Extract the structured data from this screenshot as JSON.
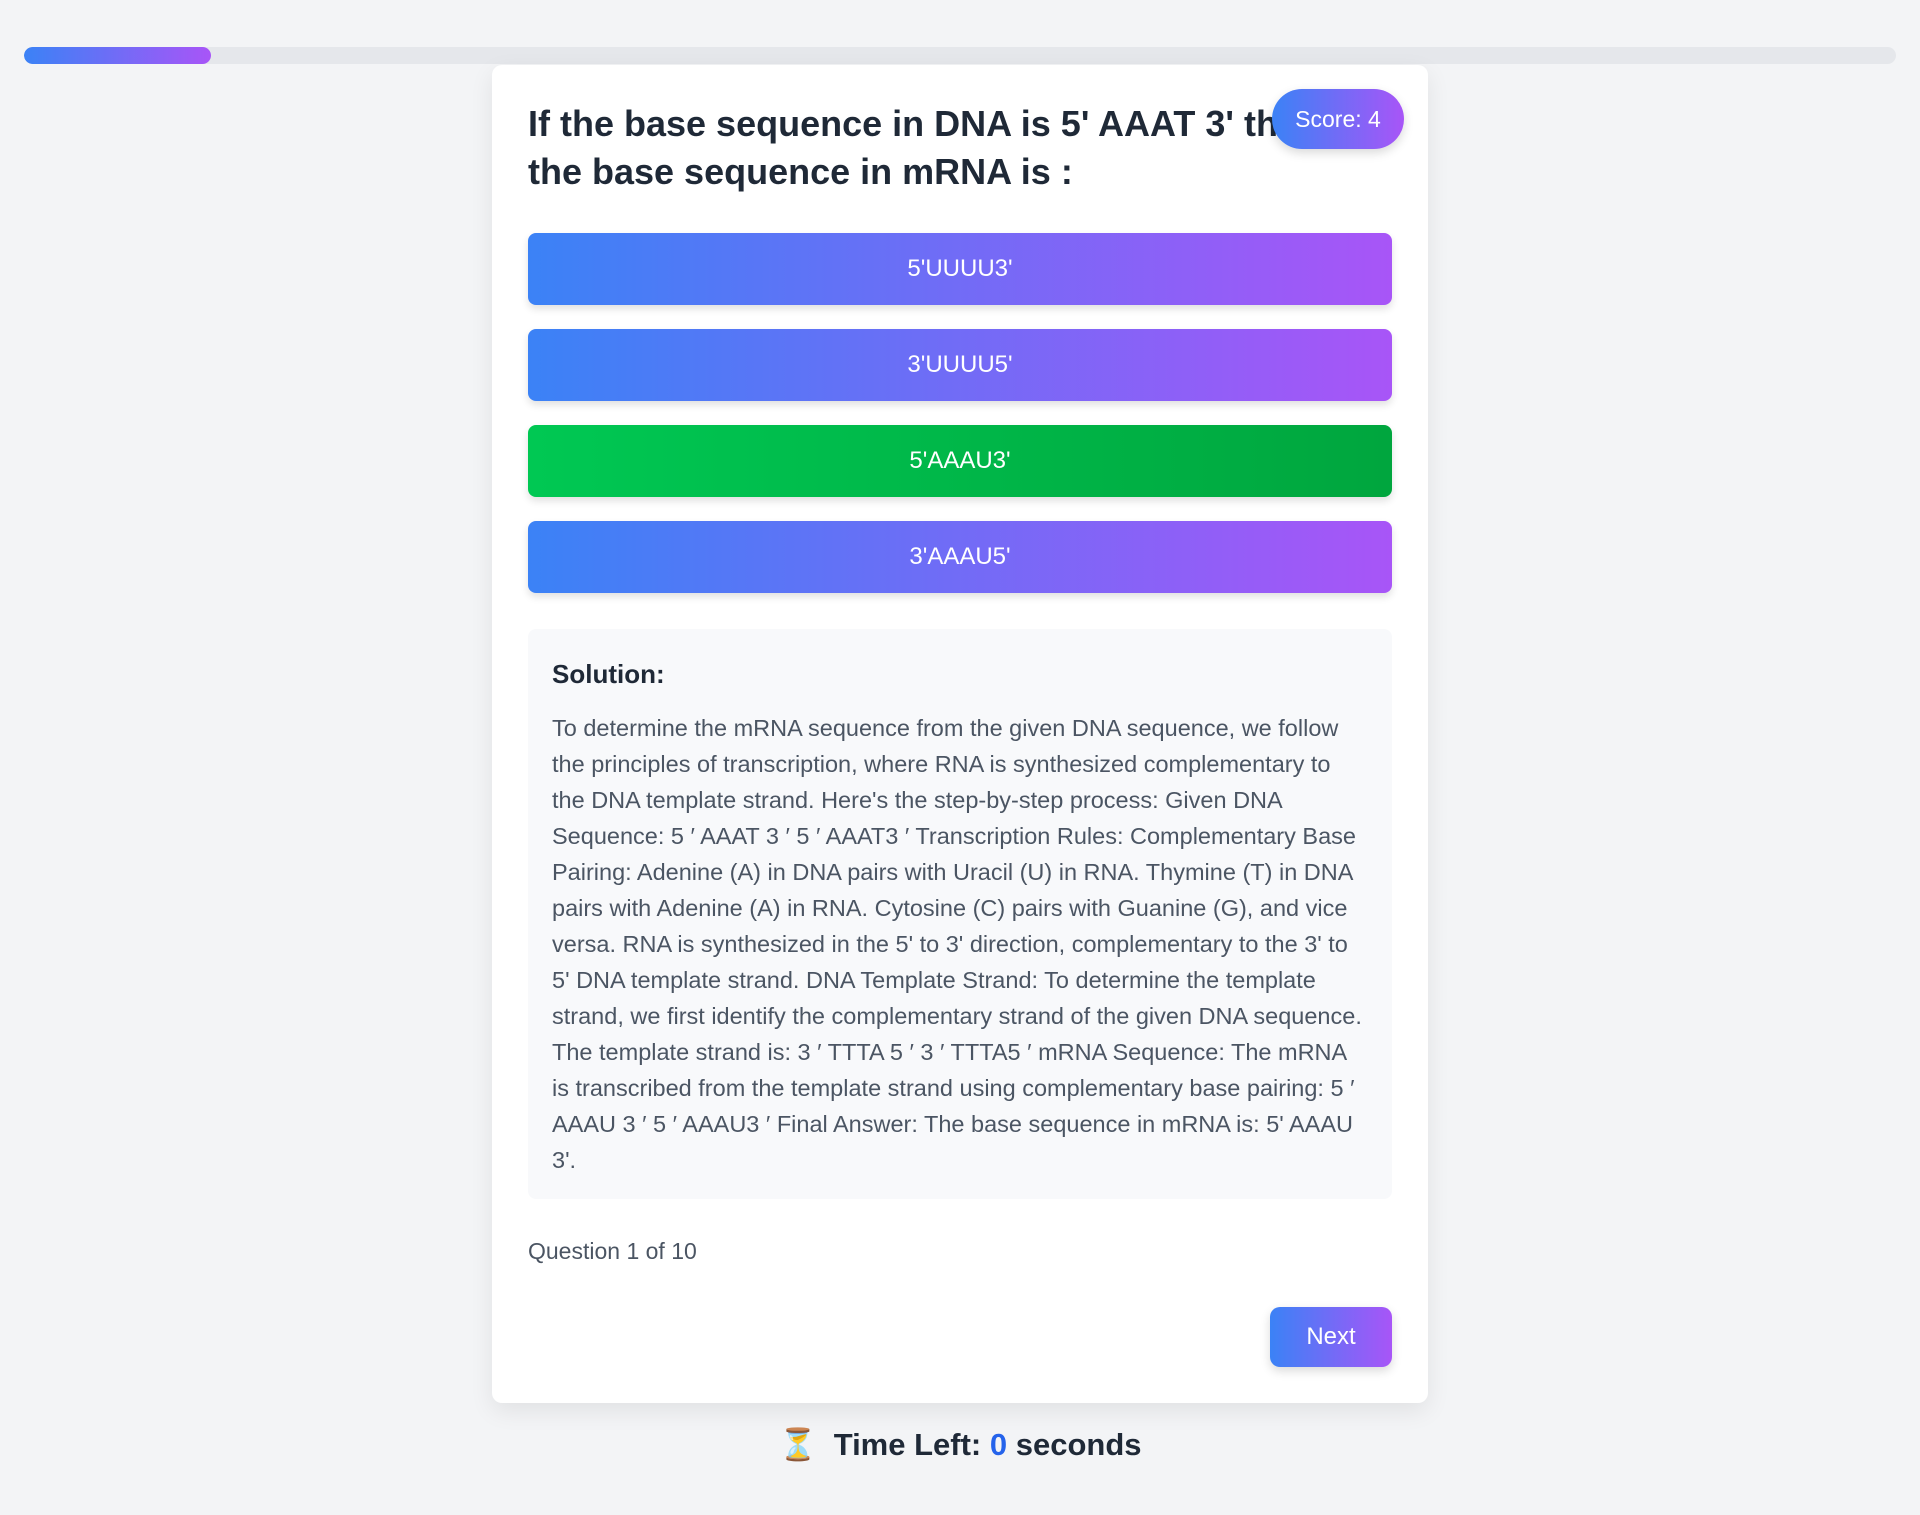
{
  "progress": {
    "current": 1,
    "total": 10,
    "fraction": 0.1
  },
  "score": {
    "label": "Score: 4",
    "value": 4
  },
  "question": {
    "text": "If the base sequence in DNA is 5' AAAT 3' then the base sequence in mRNA is :"
  },
  "options": [
    {
      "label": "5'UUUU3'",
      "state": "default"
    },
    {
      "label": "3'UUUU5'",
      "state": "default"
    },
    {
      "label": "5'AAAU3'",
      "state": "correct"
    },
    {
      "label": "3'AAAU5'",
      "state": "default"
    }
  ],
  "solution": {
    "title": "Solution:",
    "text": "To determine the mRNA sequence from the given DNA sequence, we follow the principles of transcription, where RNA is synthesized complementary to the DNA template strand. Here's the step-by-step process: Given DNA Sequence: 5 ′ AAAT 3 ′ 5 ′ AAAT3 ′ Transcription Rules: Complementary Base Pairing: Adenine (A) in DNA pairs with Uracil (U) in RNA. Thymine (T) in DNA pairs with Adenine (A) in RNA. Cytosine (C) pairs with Guanine (G), and vice versa. RNA is synthesized in the 5' to 3' direction, complementary to the 3' to 5' DNA template strand. DNA Template Strand: To determine the template strand, we first identify the complementary strand of the given DNA sequence. The template strand is: 3 ′ TTTA 5 ′ 3 ′ TTTA5 ′ mRNA Sequence: The mRNA is transcribed from the template strand using complementary base pairing: 5 ′ AAAU 3 ′ 5 ′ AAAU3 ′ Final Answer: The base sequence in mRNA is: 5' AAAU 3'."
  },
  "counter": {
    "label": "Question 1 of 10"
  },
  "next_button": {
    "label": "Next"
  },
  "timer": {
    "icon": "⏳",
    "label": "Time Left:",
    "value": "0",
    "unit": "seconds"
  },
  "colors": {
    "background": "#f3f4f6",
    "gradient_start": "#3b82f6",
    "gradient_end": "#a855f7",
    "correct_start": "#00c853",
    "correct_end": "#00a63e",
    "timer_value": "#2563eb"
  }
}
